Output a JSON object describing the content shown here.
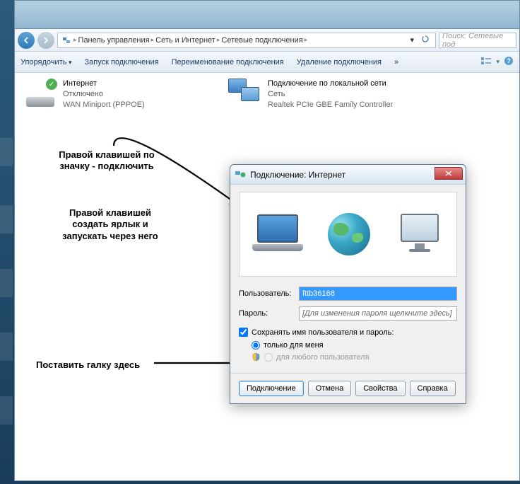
{
  "breadcrumb": {
    "item1": "Панель управления",
    "item2": "Сеть и Интернет",
    "item3": "Сетевые подключения"
  },
  "search": {
    "placeholder": "Поиск: Сетевые под"
  },
  "toolbar": {
    "organize": "Упорядочить",
    "startConn": "Запуск подключения",
    "rename": "Переименование подключения",
    "delete": "Удаление подключения",
    "more": "»"
  },
  "connections": {
    "internet": {
      "name": "Интернет",
      "status": "Отключено",
      "device": "WAN Miniport (PPPOE)"
    },
    "lan": {
      "name": "Подключение по локальной сети",
      "status": "Сеть",
      "device": "Realtek PCIe GBE Family Controller"
    }
  },
  "annotations": {
    "a1l1": "Правой клавишей по",
    "a1l2": "значку - подключить",
    "a2l1": "Правой клавишей",
    "a2l2": "создать ярлык и",
    "a2l3": "запускать через него",
    "a3": "Поставить галку здесь"
  },
  "dialog": {
    "title": "Подключение: Интернет",
    "userLabel": "Пользователь:",
    "userValue": "fttb36168",
    "passLabel": "Пароль:",
    "passPlaceholder": "[Для изменения пароля щелкните здесь]",
    "saveCreds": "Сохранять имя пользователя и пароль:",
    "onlyMe": "только для меня",
    "anyUser": "для любого пользователя",
    "btnConnect": "Подключение",
    "btnCancel": "Отмена",
    "btnProps": "Свойства",
    "btnHelp": "Справка"
  }
}
